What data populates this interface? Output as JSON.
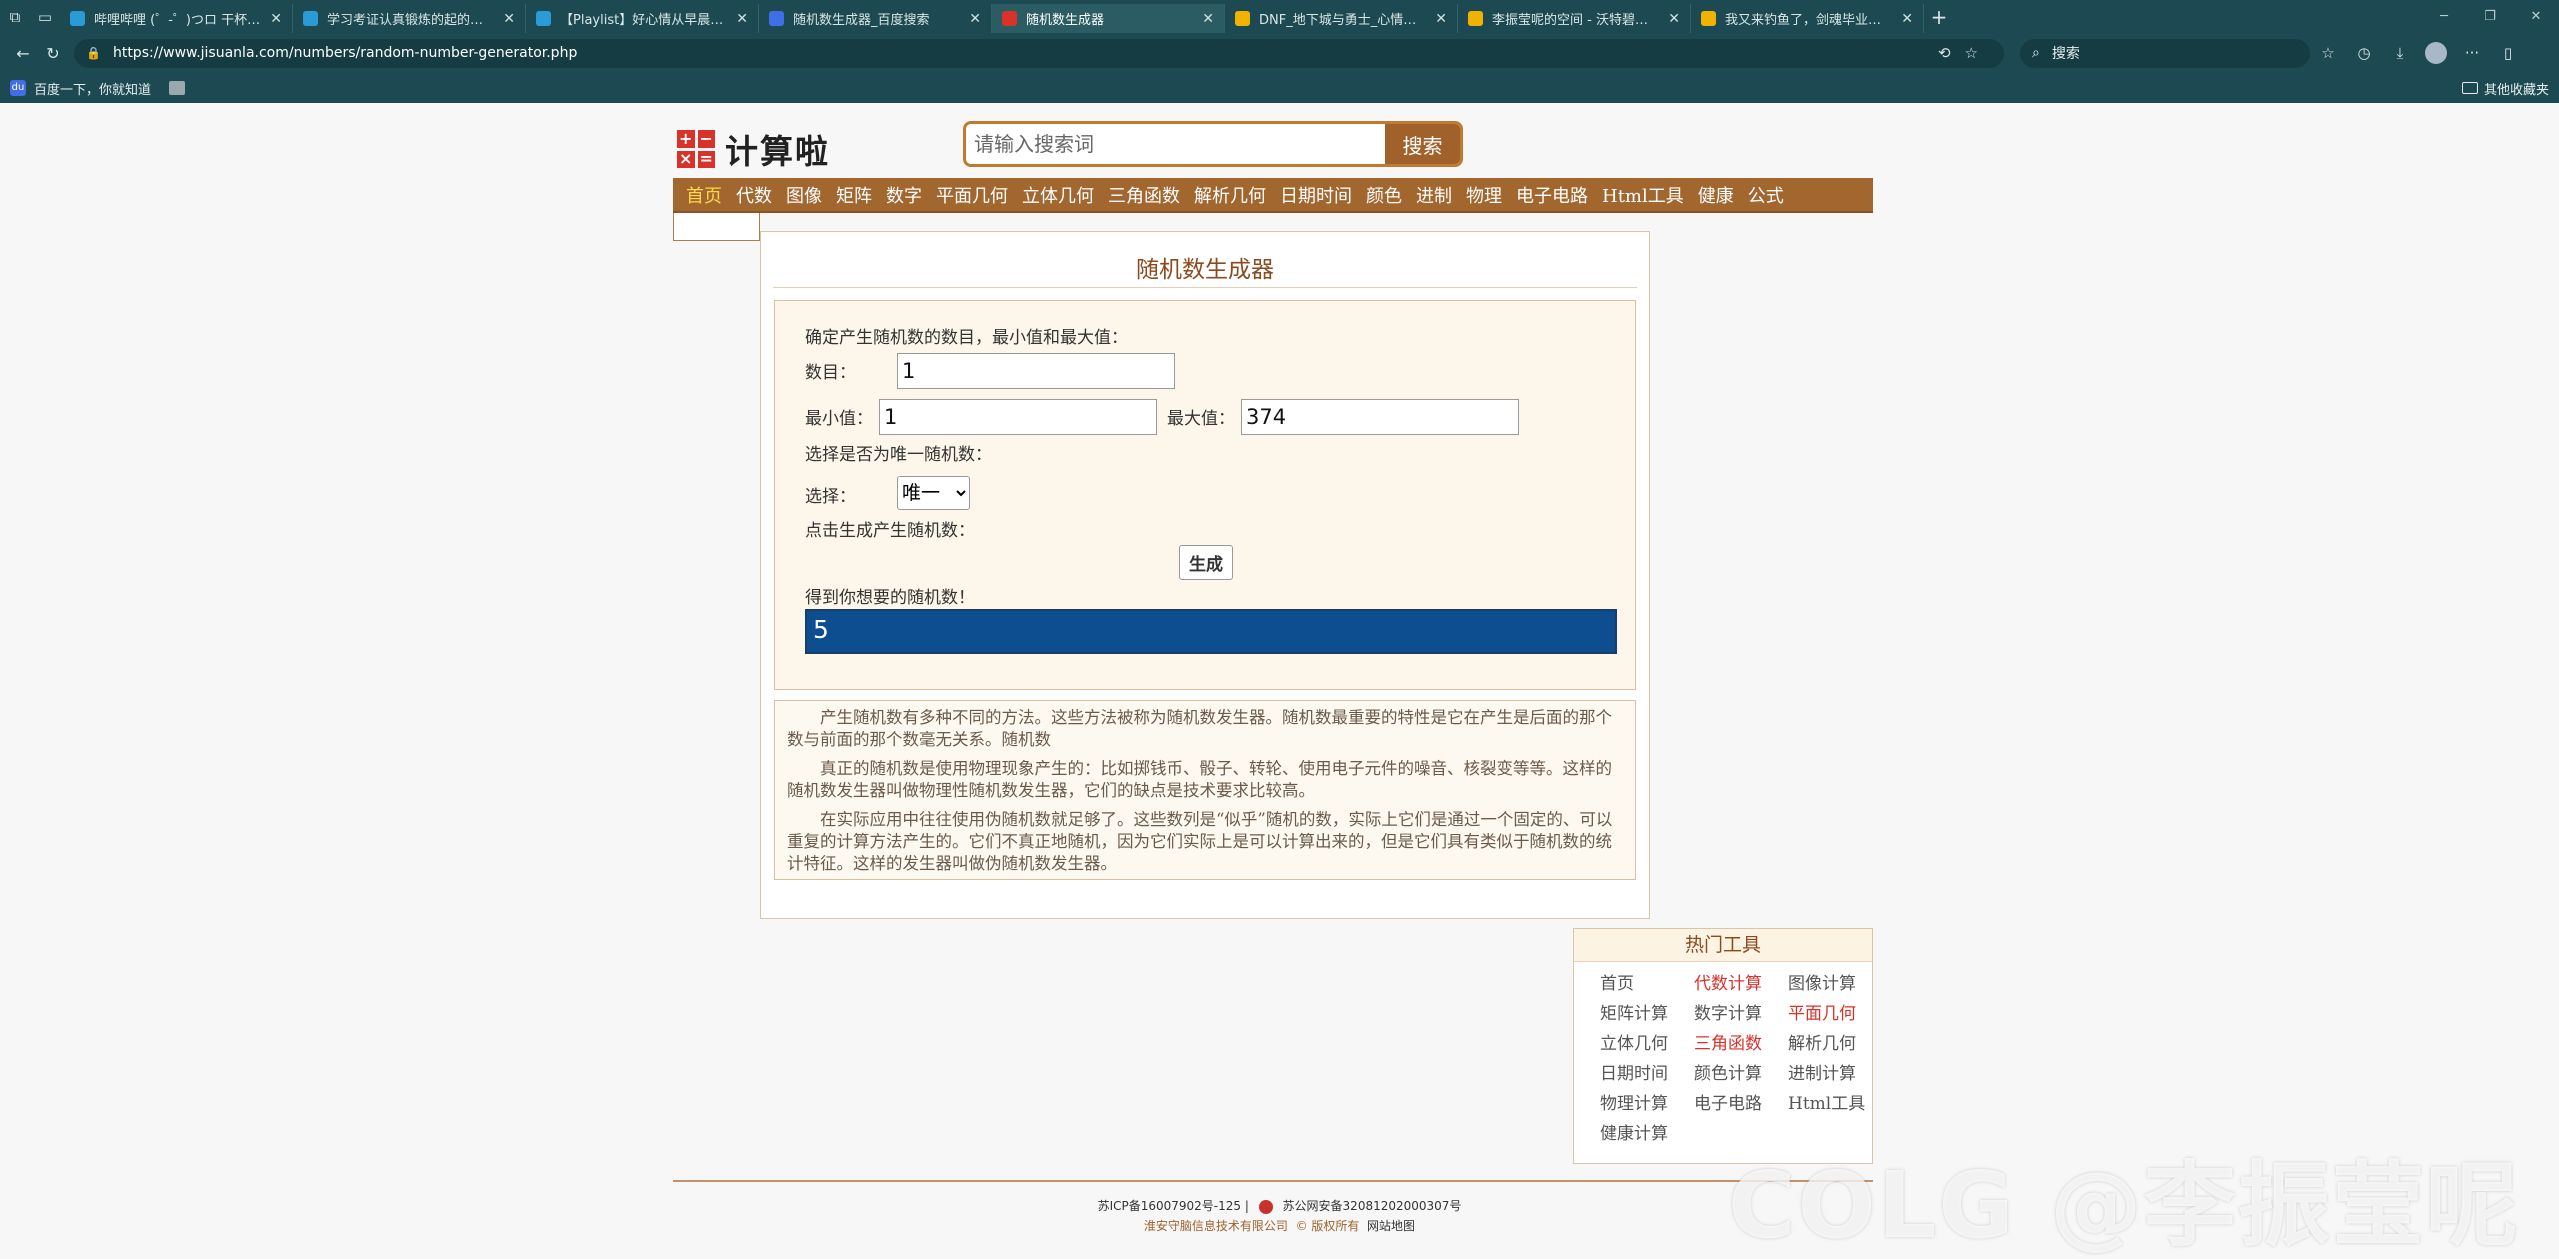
{
  "browser": {
    "tabs": [
      {
        "title": "哔哩哔哩 (゜-゜)つロ 干杯~-bilibi",
        "color": "#2a9bd6",
        "active": false
      },
      {
        "title": "学习考证认真锻炼的起的个人空间",
        "color": "#2a9bd6",
        "active": false
      },
      {
        "title": "【Playlist】好心情从早晨开始的",
        "color": "#2a9bd6",
        "active": false
      },
      {
        "title": "随机数生成器_百度搜索",
        "color": "#3f6ee6",
        "active": false
      },
      {
        "title": "随机数生成器",
        "color": "#d9322b",
        "active": true
      },
      {
        "title": "DNF_地下城与勇士_心情咖啡屋_",
        "color": "#f0b400",
        "active": false
      },
      {
        "title": "李振莹呢的空间 - 沃特碧们的Colg",
        "color": "#f0b400",
        "active": false
      },
      {
        "title": "我又来钓鱼了，剑魂毕业了。发",
        "color": "#f0b400",
        "active": false
      }
    ],
    "url": "https://www.jisuanla.com/numbers/random-number-generator.php",
    "search_placeholder": "搜索",
    "favorites": {
      "baidu": "百度一下，你就知道",
      "other": "其他收藏夹"
    }
  },
  "site": {
    "logo_text": "计算啦",
    "logo_symbols": [
      "+",
      "−",
      "×",
      "="
    ],
    "search_placeholder": "请输入搜索词",
    "search_button": "搜索",
    "nav": [
      "首页",
      "代数",
      "图像",
      "矩阵",
      "数字",
      "平面几何",
      "立体几何",
      "三角函数",
      "解析几何",
      "日期时间",
      "颜色",
      "进制",
      "物理",
      "电子电路",
      "Html工具",
      "健康",
      "公式"
    ]
  },
  "calc": {
    "title": "随机数生成器",
    "intro": "确定产生随机数的数目，最小值和最大值：",
    "count_label": "数目：",
    "count_value": "1",
    "min_label": "最小值：",
    "min_value": "1",
    "max_label": "最大值：",
    "max_value": "374",
    "unique_prompt": "选择是否为唯一随机数：",
    "select_label": "选择：",
    "select_value": "唯一",
    "generate_prompt": "点击生成产生随机数：",
    "generate_button": "生成",
    "result_prompt": "得到你想要的随机数！",
    "result_value": "5"
  },
  "description": [
    "产生随机数有多种不同的方法。这些方法被称为随机数发生器。随机数最重要的特性是它在产生是后面的那个数与前面的那个数毫无关系。随机数",
    "真正的随机数是使用物理现象产生的：比如掷钱币、骰子、转轮、使用电子元件的噪音、核裂变等等。这样的随机数发生器叫做物理性随机数发生器，它们的缺点是技术要求比较高。",
    "在实际应用中往往使用伪随机数就足够了。这些数列是“似乎”随机的数，实际上它们是通过一个固定的、可以重复的计算方法产生的。它们不真正地随机，因为它们实际上是可以计算出来的，但是它们具有类似于随机数的统计特征。这样的发生器叫做伪随机数发生器。"
  ],
  "hot_tools": {
    "title": "热门工具",
    "items": [
      {
        "label": "首页",
        "red": false
      },
      {
        "label": "代数计算",
        "red": true
      },
      {
        "label": "图像计算",
        "red": false
      },
      {
        "label": "矩阵计算",
        "red": false
      },
      {
        "label": "数字计算",
        "red": false
      },
      {
        "label": "平面几何",
        "red": true
      },
      {
        "label": "立体几何",
        "red": false
      },
      {
        "label": "三角函数",
        "red": true
      },
      {
        "label": "解析几何",
        "red": false
      },
      {
        "label": "日期时间",
        "red": false
      },
      {
        "label": "颜色计算",
        "red": false
      },
      {
        "label": "进制计算",
        "red": false
      },
      {
        "label": "物理计算",
        "red": false
      },
      {
        "label": "电子电路",
        "red": false
      },
      {
        "label": "Html工具",
        "red": false
      },
      {
        "label": "健康计算",
        "red": false
      }
    ]
  },
  "footer": {
    "icp": "苏ICP备16007902号-125 |",
    "police": "苏公网安备32081202000307号",
    "company": "淮安守脑信息技术有限公司",
    "rights": "© 版权所有",
    "sitemap": "网站地图"
  },
  "watermark": "COLG @李振莹呢"
}
